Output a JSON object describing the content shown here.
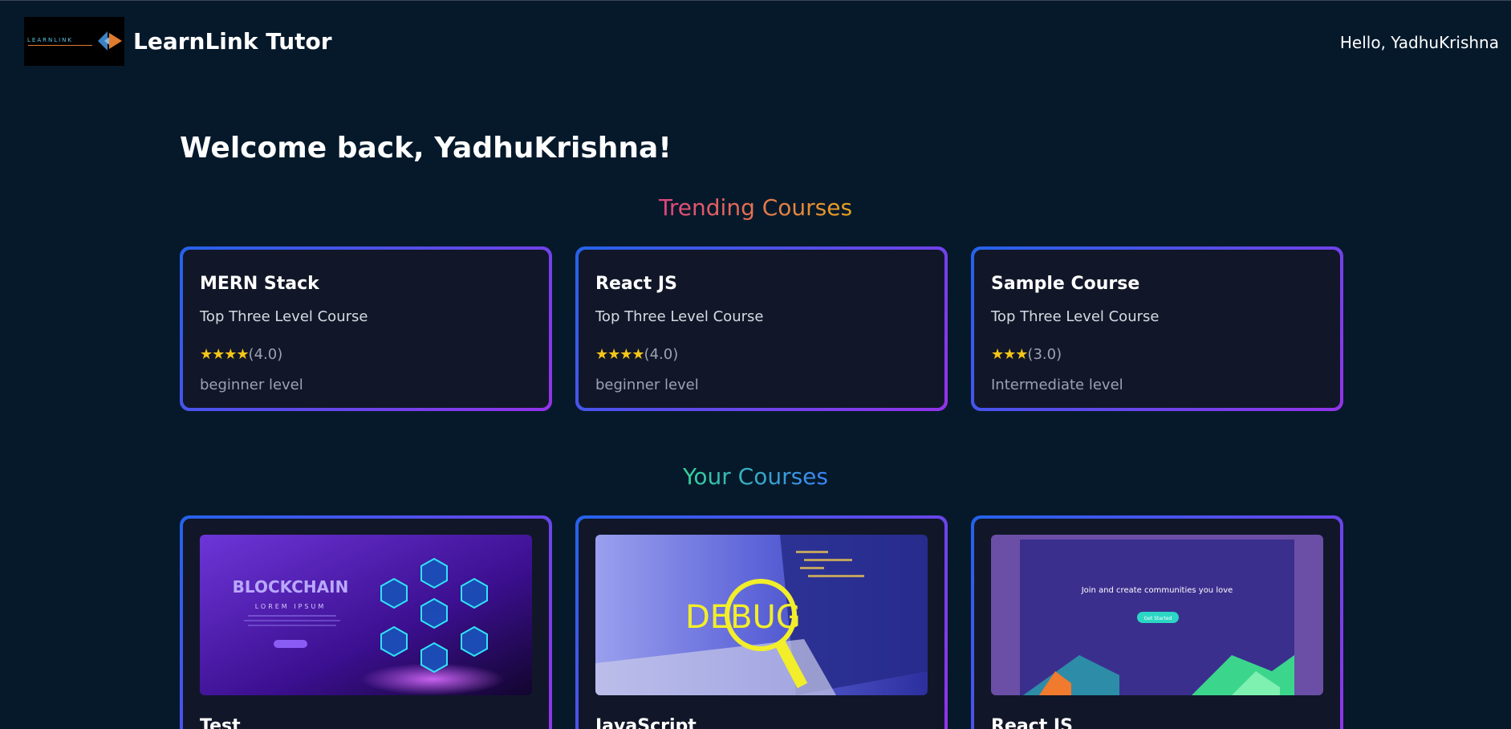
{
  "header": {
    "logo_text": "LEARNLINK",
    "brand": "LearnLink Tutor",
    "greeting": "Hello, YadhuKrishna"
  },
  "welcome": "Welcome back, YadhuKrishna!",
  "trending": {
    "title": "Trending Courses",
    "courses": [
      {
        "title": "MERN Stack",
        "subtitle": "Top Three Level Course",
        "stars": "★★★★",
        "rating": "(4.0)",
        "level": "beginner level"
      },
      {
        "title": "React JS",
        "subtitle": "Top Three Level Course",
        "stars": "★★★★",
        "rating": "(4.0)",
        "level": "beginner level"
      },
      {
        "title": "Sample Course",
        "subtitle": "Top Three Level Course",
        "stars": "★★★",
        "rating": "(3.0)",
        "level": "Intermediate level"
      }
    ]
  },
  "your_courses": {
    "title": "Your Courses",
    "courses": [
      {
        "title": "Test",
        "image": "blockchain-thumbnail",
        "img_title": "BLOCKCHAIN",
        "img_sub": "LOREM IPSUM"
      },
      {
        "title": "JavaScript",
        "image": "debug-thumbnail",
        "img_title": "DEBUG"
      },
      {
        "title": "React JS",
        "image": "community-thumbnail",
        "img_text": "Join and create communities you love",
        "img_btn": "Get Started"
      }
    ]
  },
  "colors": {
    "background": "#06192b",
    "card": "#111728",
    "border_start": "#2563eb",
    "border_end": "#9333ea",
    "star": "#f5c518"
  }
}
